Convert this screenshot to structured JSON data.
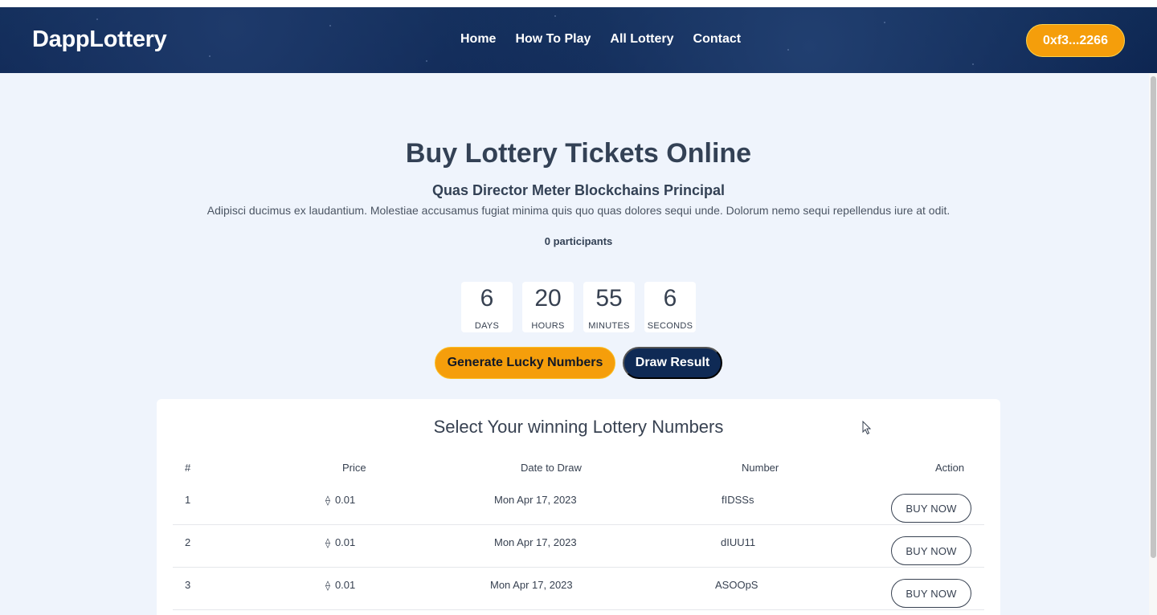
{
  "header": {
    "logo": "DappLottery",
    "nav": [
      "Home",
      "How To Play",
      "All Lottery",
      "Contact"
    ],
    "wallet": "0xf3...2266"
  },
  "hero": {
    "title": "Buy Lottery Tickets Online",
    "subtitle": "Quas Director Meter Blockchains Principal",
    "description": "Adipisci ducimus ex laudantium. Molestiae accusamus fugiat minima quis quo quas dolores sequi unde. Dolorum nemo sequi repellendus iure at odit.",
    "participants": "0 participants"
  },
  "countdown": [
    {
      "value": "6",
      "label": "DAYS"
    },
    {
      "value": "20",
      "label": "HOURS"
    },
    {
      "value": "55",
      "label": "MINUTES"
    },
    {
      "value": "6",
      "label": "SECONDS"
    }
  ],
  "actions": {
    "generate": "Generate Lucky Numbers",
    "draw": "Draw Result"
  },
  "table": {
    "title": "Select Your winning Lottery Numbers",
    "headers": {
      "index": "#",
      "price": "Price",
      "date": "Date to Draw",
      "number": "Number",
      "action": "Action"
    },
    "rows": [
      {
        "index": "1",
        "price": "0.01",
        "date": "Mon Apr 17, 2023",
        "number": "fIDSSs",
        "action": "BUY NOW"
      },
      {
        "index": "2",
        "price": "0.01",
        "date": "Mon Apr 17, 2023",
        "number": "dIUU11",
        "action": "BUY NOW"
      },
      {
        "index": "3",
        "price": "0.01",
        "date": "Mon Apr 17, 2023",
        "number": "ASOOpS",
        "action": "BUY NOW"
      }
    ],
    "currency_icon": "ethereum-icon"
  },
  "colors": {
    "header_bg": "#0f2a55",
    "accent": "#f59e0b",
    "page_bg": "#eff4fc"
  }
}
